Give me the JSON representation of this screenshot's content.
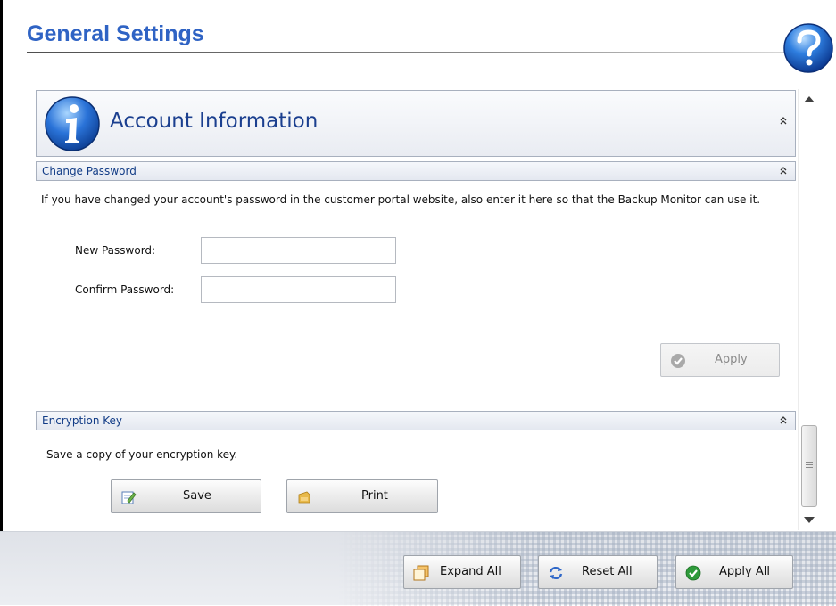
{
  "page": {
    "title": "General Settings"
  },
  "icons": {
    "help": "help-icon",
    "info": "info-icon",
    "collapse": "double-chevron-up-icon"
  },
  "colors": {
    "title_blue": "#2f63c4",
    "section_blue": "#123c86"
  },
  "account": {
    "title": "Account Information"
  },
  "change_password": {
    "title": "Change Password",
    "description": "If you have changed your account's password in the customer portal website, also enter it here so that the Backup Monitor can use it.",
    "new_password_label": "New Password:",
    "new_password_value": "",
    "confirm_password_label": "Confirm Password:",
    "confirm_password_value": "",
    "apply_label": "Apply"
  },
  "encryption": {
    "title": "Encryption Key",
    "description": "Save a copy of your encryption key.",
    "save_label": "Save",
    "print_label": "Print"
  },
  "footer": {
    "expand_all_label": "Expand All",
    "reset_all_label": "Reset All",
    "apply_all_label": "Apply All"
  }
}
